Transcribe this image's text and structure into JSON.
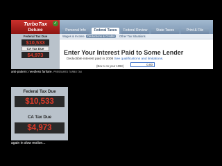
{
  "app": {
    "brand": "TurboTax",
    "brand_sub": "Deluxe"
  },
  "tabs": [
    "Personal Info",
    "Federal Taxes",
    "Federal Review",
    "State Taxes",
    "Print & File"
  ],
  "active_tab": "Federal Taxes",
  "subnav": [
    "Wages & Income",
    "Deductions & Credits",
    "Other Tax Situations"
  ],
  "active_subnav": "Deductions & Credits",
  "sidebar": {
    "federal_label": "Federal Tax Due",
    "federal_value": "$10,533",
    "ca_label": "CA Tax Due",
    "ca_value": "$4,973"
  },
  "main": {
    "heading": "Enter Your Interest Paid to Some Lender",
    "subline": "Deductible interest paid in 2008",
    "link": "See qualifications and limitations.",
    "box_label": "(Box 1 on your 1098)",
    "amount_value": "0.00"
  },
  "captions": {
    "first": "anti-pattern: needless fanfare.",
    "first_small": "PRESSURED TURBO TAX",
    "second": "again in slow motion..."
  },
  "zoom": {
    "federal_label": "Federal Tax Due",
    "federal_value": "$10,533",
    "ca_label": "CA Tax Due",
    "ca_value": "$4,973"
  },
  "colors": {
    "due_red": "#e23a2a",
    "tab_blue": "#7c96b3",
    "sidebar_gray": "#b9c2cb"
  }
}
